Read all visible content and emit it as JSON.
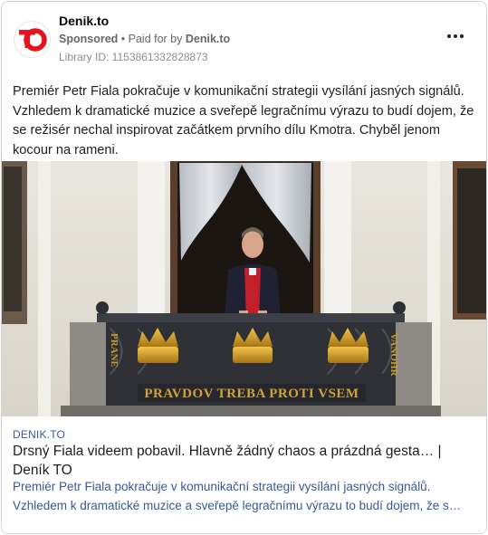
{
  "post": {
    "page_name": "Denik.to",
    "sponsored_label": "Sponsored",
    "separator": " • ",
    "paid_for_prefix": "Paid for by ",
    "payer": "Denik.to",
    "library_id": "Library ID: 1153861332828873",
    "avatar_icon": "denik-to-logo-icon",
    "brand_color": "#e3141b",
    "more_icon": "more-options-icon",
    "body_text": "Premiér Petr Fiala pokračuje v komunikační strategii vysílání jasných signálů. Vzhledem k dramatické muzice a sveřepě legračnímu výrazu to budí dojem, že se režisér nechal inspirovat začátkem prvního dílu Kmotra. Chyběl jenom kocour na rameni."
  },
  "image": {
    "banner_text": "PRAVDOV TREBA PROTI VSEM",
    "left_side_text": "PRANE",
    "right_side_text": "VANOHR"
  },
  "link": {
    "domain": "DENIK.TO",
    "title": "Drsný Fiala videem pobavil. Hlavně žádný chaos a prázdná gesta… | Deník TO",
    "description_line1": "Premiér Petr Fiala pokračuje v komunikační strategii vysílání jasných signálů.",
    "description_line2": "Vzhledem k dramatické muzice a sveřepě legračnímu výrazu to budí dojem, že s…"
  }
}
